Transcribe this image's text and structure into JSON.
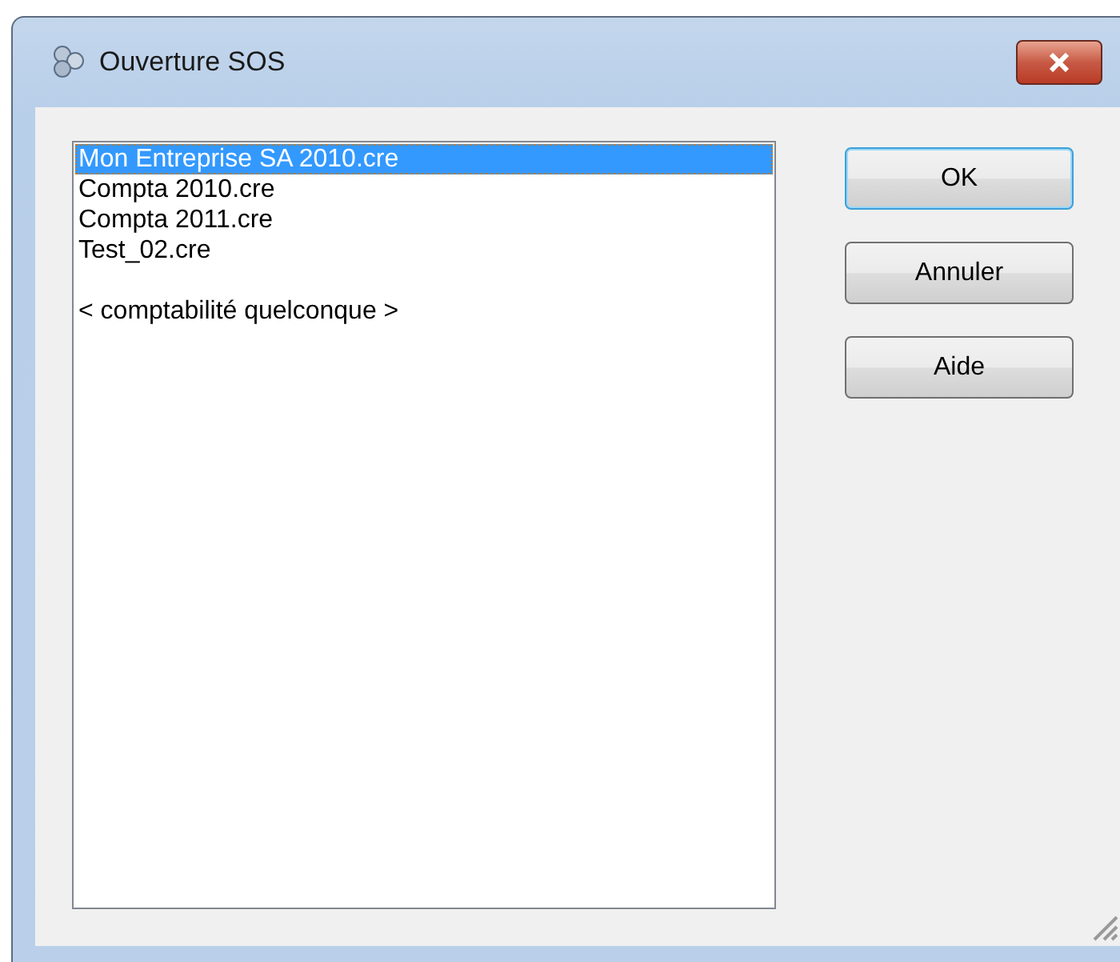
{
  "window": {
    "title": "Ouverture SOS"
  },
  "list": {
    "items": [
      {
        "label": "Mon Entreprise SA 2010.cre",
        "selected": true,
        "kind": "file"
      },
      {
        "label": "Compta 2010.cre",
        "selected": false,
        "kind": "file"
      },
      {
        "label": "Compta 2011.cre",
        "selected": false,
        "kind": "file"
      },
      {
        "label": "Test_02.cre",
        "selected": false,
        "kind": "file"
      },
      {
        "label": "< comptabilité quelconque >",
        "selected": false,
        "kind": "other"
      }
    ]
  },
  "buttons": [
    {
      "label": "OK",
      "default": true
    },
    {
      "label": "Annuler",
      "default": false
    },
    {
      "label": "Aide",
      "default": false
    }
  ]
}
